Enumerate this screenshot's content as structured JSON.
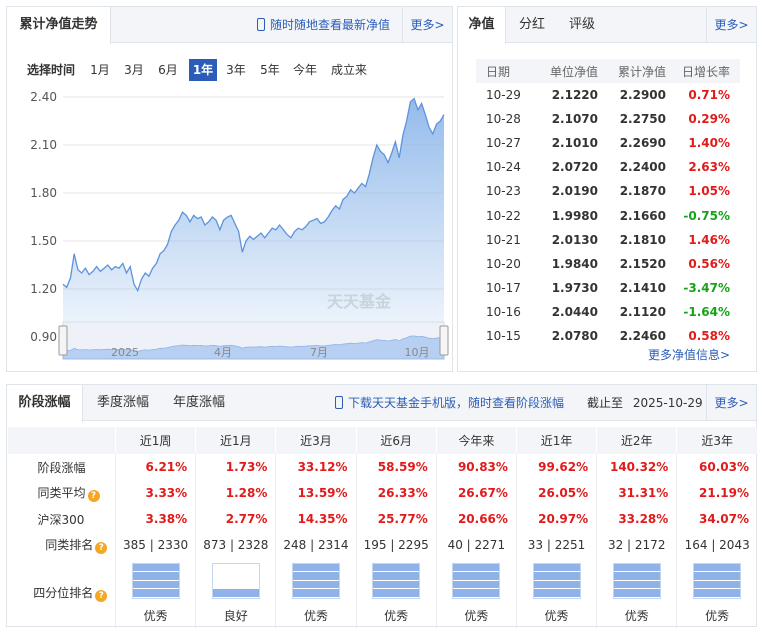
{
  "trend": {
    "tab_title": "累计净值走势",
    "tip": "随时随地查看最新净值",
    "more": "更多>",
    "range_label": "选择时间",
    "ranges": [
      "1月",
      "3月",
      "6月",
      "1年",
      "3年",
      "5年",
      "今年",
      "成立来"
    ],
    "active_range": "1年",
    "watermark": "天天基金"
  },
  "chart_data": {
    "type": "area",
    "y_ticks": [
      "2.40",
      "2.10",
      "1.80",
      "1.50",
      "1.20",
      "0.90"
    ],
    "ylim": [
      0.9,
      2.4
    ],
    "navigator_labels": [
      "2025",
      "4月",
      "7月",
      "10月"
    ],
    "series": [
      {
        "values": [
          1.23,
          1.21,
          1.27,
          1.42,
          1.32,
          1.3,
          1.33,
          1.29,
          1.31,
          1.34,
          1.31,
          1.33,
          1.35,
          1.32,
          1.34,
          1.33,
          1.36,
          1.3,
          1.34,
          1.23,
          1.19,
          1.26,
          1.3,
          1.28,
          1.33,
          1.36,
          1.42,
          1.44,
          1.48,
          1.56,
          1.6,
          1.63,
          1.68,
          1.66,
          1.62,
          1.66,
          1.64,
          1.65,
          1.6,
          1.62,
          1.65,
          1.63,
          1.57,
          1.63,
          1.65,
          1.66,
          1.61,
          1.56,
          1.43,
          1.5,
          1.53,
          1.51,
          1.53,
          1.55,
          1.52,
          1.55,
          1.58,
          1.57,
          1.6,
          1.57,
          1.54,
          1.52,
          1.56,
          1.58,
          1.57,
          1.59,
          1.62,
          1.63,
          1.64,
          1.61,
          1.62,
          1.65,
          1.69,
          1.72,
          1.7,
          1.76,
          1.78,
          1.82,
          1.8,
          1.83,
          1.86,
          1.84,
          1.92,
          2.02,
          2.1,
          2.06,
          2.04,
          1.99,
          2.05,
          2.12,
          2.02,
          2.16,
          2.25,
          2.37,
          2.39,
          2.32,
          2.36,
          2.29,
          2.21,
          2.17,
          2.23,
          2.25,
          2.29
        ]
      }
    ]
  },
  "nav": {
    "tabs": [
      "净值",
      "分红",
      "评级"
    ],
    "more": "更多>",
    "headers": [
      "日期",
      "单位净值",
      "累计净值",
      "日增长率"
    ],
    "rows": [
      {
        "date": "10-29",
        "unit": "2.1220",
        "acc": "2.2900",
        "growth": "0.71%",
        "dir": "up"
      },
      {
        "date": "10-28",
        "unit": "2.1070",
        "acc": "2.2750",
        "growth": "0.29%",
        "dir": "up"
      },
      {
        "date": "10-27",
        "unit": "2.1010",
        "acc": "2.2690",
        "growth": "1.40%",
        "dir": "up"
      },
      {
        "date": "10-24",
        "unit": "2.0720",
        "acc": "2.2400",
        "growth": "2.63%",
        "dir": "up"
      },
      {
        "date": "10-23",
        "unit": "2.0190",
        "acc": "2.1870",
        "growth": "1.05%",
        "dir": "up"
      },
      {
        "date": "10-22",
        "unit": "1.9980",
        "acc": "2.1660",
        "growth": "-0.75%",
        "dir": "down"
      },
      {
        "date": "10-21",
        "unit": "2.0130",
        "acc": "2.1810",
        "growth": "1.46%",
        "dir": "up"
      },
      {
        "date": "10-20",
        "unit": "1.9840",
        "acc": "2.1520",
        "growth": "0.56%",
        "dir": "up"
      },
      {
        "date": "10-17",
        "unit": "1.9730",
        "acc": "2.1410",
        "growth": "-3.47%",
        "dir": "down"
      },
      {
        "date": "10-16",
        "unit": "2.0440",
        "acc": "2.1120",
        "growth": "-1.64%",
        "dir": "down"
      },
      {
        "date": "10-15",
        "unit": "2.0780",
        "acc": "2.2460",
        "growth": "0.58%",
        "dir": "up"
      }
    ],
    "more_link": "更多净值信息>"
  },
  "stage": {
    "tabs": [
      "阶段涨幅",
      "季度涨幅",
      "年度涨幅"
    ],
    "tip": "下载天天基金手机版，随时查看阶段涨幅",
    "as_of_label": "截止至",
    "as_of": "2025-10-29",
    "more": "更多>",
    "periods": [
      "近1周",
      "近1月",
      "近3月",
      "近6月",
      "今年来",
      "近1年",
      "近2年",
      "近3年"
    ],
    "rows": [
      {
        "label": "阶段涨幅",
        "help": false,
        "values": [
          "6.21%",
          "1.73%",
          "33.12%",
          "58.59%",
          "90.83%",
          "99.62%",
          "140.32%",
          "60.03%"
        ]
      },
      {
        "label": "同类平均",
        "help": true,
        "values": [
          "3.33%",
          "1.28%",
          "13.59%",
          "26.33%",
          "26.67%",
          "26.05%",
          "31.31%",
          "21.19%"
        ]
      },
      {
        "label": "沪深300",
        "help": false,
        "values": [
          "3.38%",
          "2.77%",
          "14.35%",
          "25.77%",
          "20.66%",
          "20.97%",
          "33.28%",
          "34.07%"
        ]
      }
    ],
    "rank_label": "同类排名",
    "ranks": [
      "385 | 2330",
      "873 | 2328",
      "248 | 2314",
      "195 | 2295",
      "40 | 2271",
      "33 | 2251",
      "32 | 2172",
      "164 | 2043"
    ],
    "quartile_label": "四分位排名",
    "quartile_levels": [
      4,
      1,
      4,
      4,
      4,
      4,
      4,
      4
    ],
    "quartile_text": [
      "优秀",
      "良好",
      "优秀",
      "优秀",
      "优秀",
      "优秀",
      "优秀",
      "优秀"
    ]
  },
  "colors": {
    "accent": "#2b5db8",
    "up": "#e11b1b",
    "down": "#17a317",
    "area": "#8fb8ea"
  }
}
